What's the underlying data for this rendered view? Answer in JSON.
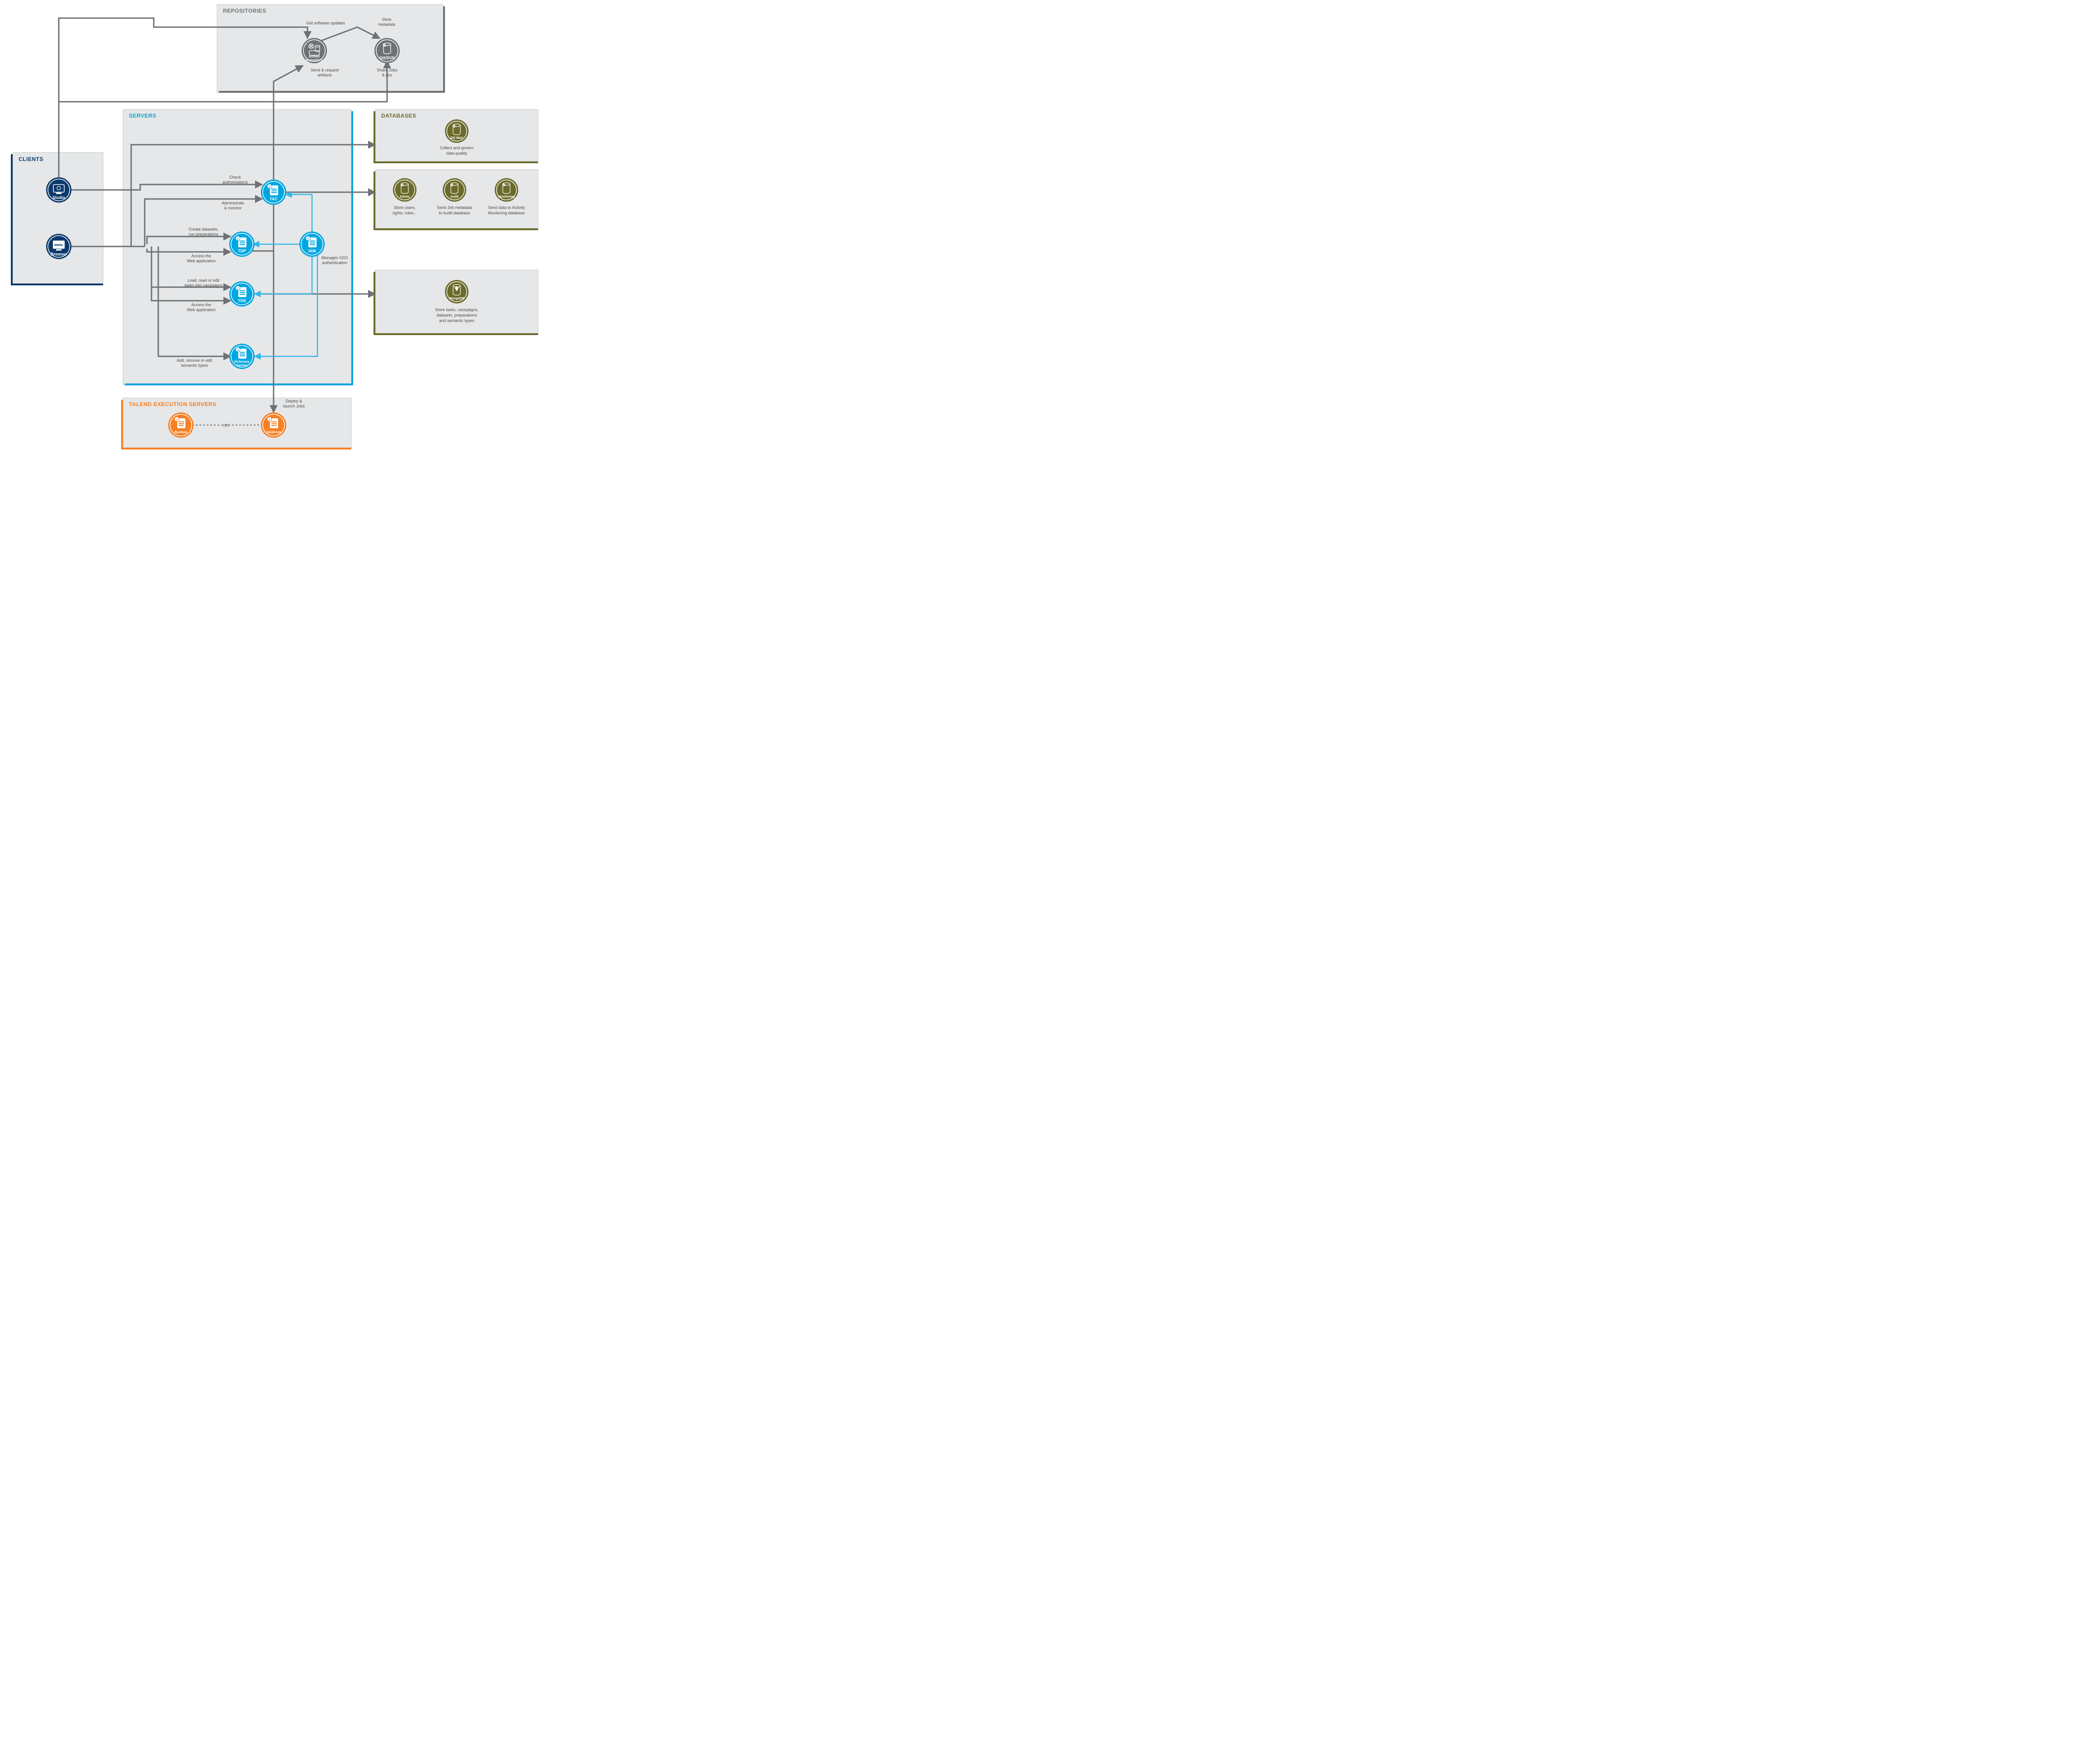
{
  "colors": {
    "bg_group": "#e6e7e8",
    "stroke_group": "#b9babb",
    "dark_gray": "#6f7274",
    "text_gray": "#565a5c",
    "navy": "#0c3a6c",
    "cyan": "#00a6e0",
    "cyan_light": "#33b8e6",
    "olive": "#6b6a2a",
    "orange": "#f58025",
    "white": "#ffffff"
  },
  "groups": {
    "clients": {
      "title": "CLIENTS"
    },
    "repositories": {
      "title": "REPOSITORIES"
    },
    "servers": {
      "title": "SERVERS"
    },
    "databases": {
      "title": "DATABASES"
    },
    "execution": {
      "title": "TALEND EXECUTION SERVERS"
    }
  },
  "nodes": {
    "studio": {
      "label": "Studio"
    },
    "browser": {
      "label": "Browser",
      "inner": "www."
    },
    "artifact": {
      "label1": "Artifact",
      "label2": "Repository"
    },
    "gitsvn": {
      "label": "Git/SVN"
    },
    "tac": {
      "label": "TAC"
    },
    "tdp": {
      "label": "TDP"
    },
    "tds": {
      "label": "TDS"
    },
    "dict": {
      "label1": "Dictionary",
      "label2": "Service"
    },
    "iam": {
      "label": "IAM"
    },
    "dqmart": {
      "label": "DQ Mart"
    },
    "admin": {
      "label": "Admin"
    },
    "audit": {
      "label": "Audit"
    },
    "monitor": {
      "label": "Monitoring"
    },
    "mongo": {
      "label": "MongoDB"
    },
    "runtime": {
      "label": "Runtime"
    },
    "jobserver": {
      "label": "JobServer"
    }
  },
  "labels": {
    "get_updates": "Get software updates",
    "store_metadata1": "Store",
    "store_metadata2": "metadata",
    "send_artifacts1": "Send & request",
    "send_artifacts2": "artifacts",
    "share_jobs1": "Share Jobs",
    "share_jobs2": "& doc",
    "check_auth1": "Check",
    "check_auth2": "authorizations",
    "admin_mon1": "Administrate",
    "admin_mon2": "& monitor",
    "create_ds1": "Create datasets,",
    "create_ds2": "run preparations",
    "access_web1": "Access the",
    "access_web2": "Web application",
    "load_tasks1": "Load, read or edit",
    "load_tasks2": "tasks into campaigns",
    "add_sem1": "Add, remove or edit",
    "add_sem2": "semantic types",
    "manages_sso1": "Manages SSO",
    "manages_sso2": "authentication",
    "deploy1": "Deploy &",
    "deploy2": "launch Jobs",
    "dq_desc1": "Collect and govern",
    "dq_desc2": "data quality",
    "admin_desc1": "Store users,",
    "admin_desc2": "rights, roles...",
    "audit_desc1": "Send Job metadata",
    "audit_desc2": "to Audit database",
    "mon_desc1": "Send data to Activity",
    "mon_desc2": "Monitoring database",
    "mongo_desc1": "Store tasks, campaigns,",
    "mongo_desc2": "datasets, preparations",
    "mongo_desc3": "and semantic types",
    "or": "OR"
  }
}
